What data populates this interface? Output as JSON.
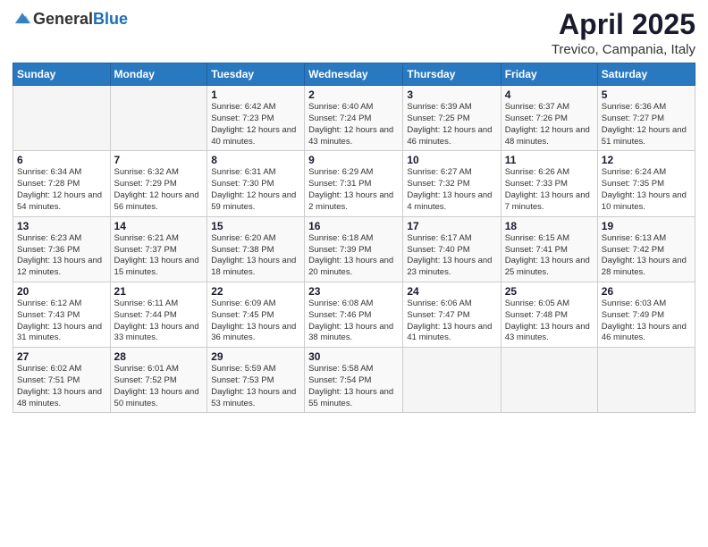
{
  "header": {
    "logo_general": "General",
    "logo_blue": "Blue",
    "month_year": "April 2025",
    "location": "Trevico, Campania, Italy"
  },
  "days_of_week": [
    "Sunday",
    "Monday",
    "Tuesday",
    "Wednesday",
    "Thursday",
    "Friday",
    "Saturday"
  ],
  "weeks": [
    [
      {
        "day": "",
        "sunrise": "",
        "sunset": "",
        "daylight": ""
      },
      {
        "day": "",
        "sunrise": "",
        "sunset": "",
        "daylight": ""
      },
      {
        "day": "1",
        "sunrise": "Sunrise: 6:42 AM",
        "sunset": "Sunset: 7:23 PM",
        "daylight": "Daylight: 12 hours and 40 minutes."
      },
      {
        "day": "2",
        "sunrise": "Sunrise: 6:40 AM",
        "sunset": "Sunset: 7:24 PM",
        "daylight": "Daylight: 12 hours and 43 minutes."
      },
      {
        "day": "3",
        "sunrise": "Sunrise: 6:39 AM",
        "sunset": "Sunset: 7:25 PM",
        "daylight": "Daylight: 12 hours and 46 minutes."
      },
      {
        "day": "4",
        "sunrise": "Sunrise: 6:37 AM",
        "sunset": "Sunset: 7:26 PM",
        "daylight": "Daylight: 12 hours and 48 minutes."
      },
      {
        "day": "5",
        "sunrise": "Sunrise: 6:36 AM",
        "sunset": "Sunset: 7:27 PM",
        "daylight": "Daylight: 12 hours and 51 minutes."
      }
    ],
    [
      {
        "day": "6",
        "sunrise": "Sunrise: 6:34 AM",
        "sunset": "Sunset: 7:28 PM",
        "daylight": "Daylight: 12 hours and 54 minutes."
      },
      {
        "day": "7",
        "sunrise": "Sunrise: 6:32 AM",
        "sunset": "Sunset: 7:29 PM",
        "daylight": "Daylight: 12 hours and 56 minutes."
      },
      {
        "day": "8",
        "sunrise": "Sunrise: 6:31 AM",
        "sunset": "Sunset: 7:30 PM",
        "daylight": "Daylight: 12 hours and 59 minutes."
      },
      {
        "day": "9",
        "sunrise": "Sunrise: 6:29 AM",
        "sunset": "Sunset: 7:31 PM",
        "daylight": "Daylight: 13 hours and 2 minutes."
      },
      {
        "day": "10",
        "sunrise": "Sunrise: 6:27 AM",
        "sunset": "Sunset: 7:32 PM",
        "daylight": "Daylight: 13 hours and 4 minutes."
      },
      {
        "day": "11",
        "sunrise": "Sunrise: 6:26 AM",
        "sunset": "Sunset: 7:33 PM",
        "daylight": "Daylight: 13 hours and 7 minutes."
      },
      {
        "day": "12",
        "sunrise": "Sunrise: 6:24 AM",
        "sunset": "Sunset: 7:35 PM",
        "daylight": "Daylight: 13 hours and 10 minutes."
      }
    ],
    [
      {
        "day": "13",
        "sunrise": "Sunrise: 6:23 AM",
        "sunset": "Sunset: 7:36 PM",
        "daylight": "Daylight: 13 hours and 12 minutes."
      },
      {
        "day": "14",
        "sunrise": "Sunrise: 6:21 AM",
        "sunset": "Sunset: 7:37 PM",
        "daylight": "Daylight: 13 hours and 15 minutes."
      },
      {
        "day": "15",
        "sunrise": "Sunrise: 6:20 AM",
        "sunset": "Sunset: 7:38 PM",
        "daylight": "Daylight: 13 hours and 18 minutes."
      },
      {
        "day": "16",
        "sunrise": "Sunrise: 6:18 AM",
        "sunset": "Sunset: 7:39 PM",
        "daylight": "Daylight: 13 hours and 20 minutes."
      },
      {
        "day": "17",
        "sunrise": "Sunrise: 6:17 AM",
        "sunset": "Sunset: 7:40 PM",
        "daylight": "Daylight: 13 hours and 23 minutes."
      },
      {
        "day": "18",
        "sunrise": "Sunrise: 6:15 AM",
        "sunset": "Sunset: 7:41 PM",
        "daylight": "Daylight: 13 hours and 25 minutes."
      },
      {
        "day": "19",
        "sunrise": "Sunrise: 6:13 AM",
        "sunset": "Sunset: 7:42 PM",
        "daylight": "Daylight: 13 hours and 28 minutes."
      }
    ],
    [
      {
        "day": "20",
        "sunrise": "Sunrise: 6:12 AM",
        "sunset": "Sunset: 7:43 PM",
        "daylight": "Daylight: 13 hours and 31 minutes."
      },
      {
        "day": "21",
        "sunrise": "Sunrise: 6:11 AM",
        "sunset": "Sunset: 7:44 PM",
        "daylight": "Daylight: 13 hours and 33 minutes."
      },
      {
        "day": "22",
        "sunrise": "Sunrise: 6:09 AM",
        "sunset": "Sunset: 7:45 PM",
        "daylight": "Daylight: 13 hours and 36 minutes."
      },
      {
        "day": "23",
        "sunrise": "Sunrise: 6:08 AM",
        "sunset": "Sunset: 7:46 PM",
        "daylight": "Daylight: 13 hours and 38 minutes."
      },
      {
        "day": "24",
        "sunrise": "Sunrise: 6:06 AM",
        "sunset": "Sunset: 7:47 PM",
        "daylight": "Daylight: 13 hours and 41 minutes."
      },
      {
        "day": "25",
        "sunrise": "Sunrise: 6:05 AM",
        "sunset": "Sunset: 7:48 PM",
        "daylight": "Daylight: 13 hours and 43 minutes."
      },
      {
        "day": "26",
        "sunrise": "Sunrise: 6:03 AM",
        "sunset": "Sunset: 7:49 PM",
        "daylight": "Daylight: 13 hours and 46 minutes."
      }
    ],
    [
      {
        "day": "27",
        "sunrise": "Sunrise: 6:02 AM",
        "sunset": "Sunset: 7:51 PM",
        "daylight": "Daylight: 13 hours and 48 minutes."
      },
      {
        "day": "28",
        "sunrise": "Sunrise: 6:01 AM",
        "sunset": "Sunset: 7:52 PM",
        "daylight": "Daylight: 13 hours and 50 minutes."
      },
      {
        "day": "29",
        "sunrise": "Sunrise: 5:59 AM",
        "sunset": "Sunset: 7:53 PM",
        "daylight": "Daylight: 13 hours and 53 minutes."
      },
      {
        "day": "30",
        "sunrise": "Sunrise: 5:58 AM",
        "sunset": "Sunset: 7:54 PM",
        "daylight": "Daylight: 13 hours and 55 minutes."
      },
      {
        "day": "",
        "sunrise": "",
        "sunset": "",
        "daylight": ""
      },
      {
        "day": "",
        "sunrise": "",
        "sunset": "",
        "daylight": ""
      },
      {
        "day": "",
        "sunrise": "",
        "sunset": "",
        "daylight": ""
      }
    ]
  ]
}
